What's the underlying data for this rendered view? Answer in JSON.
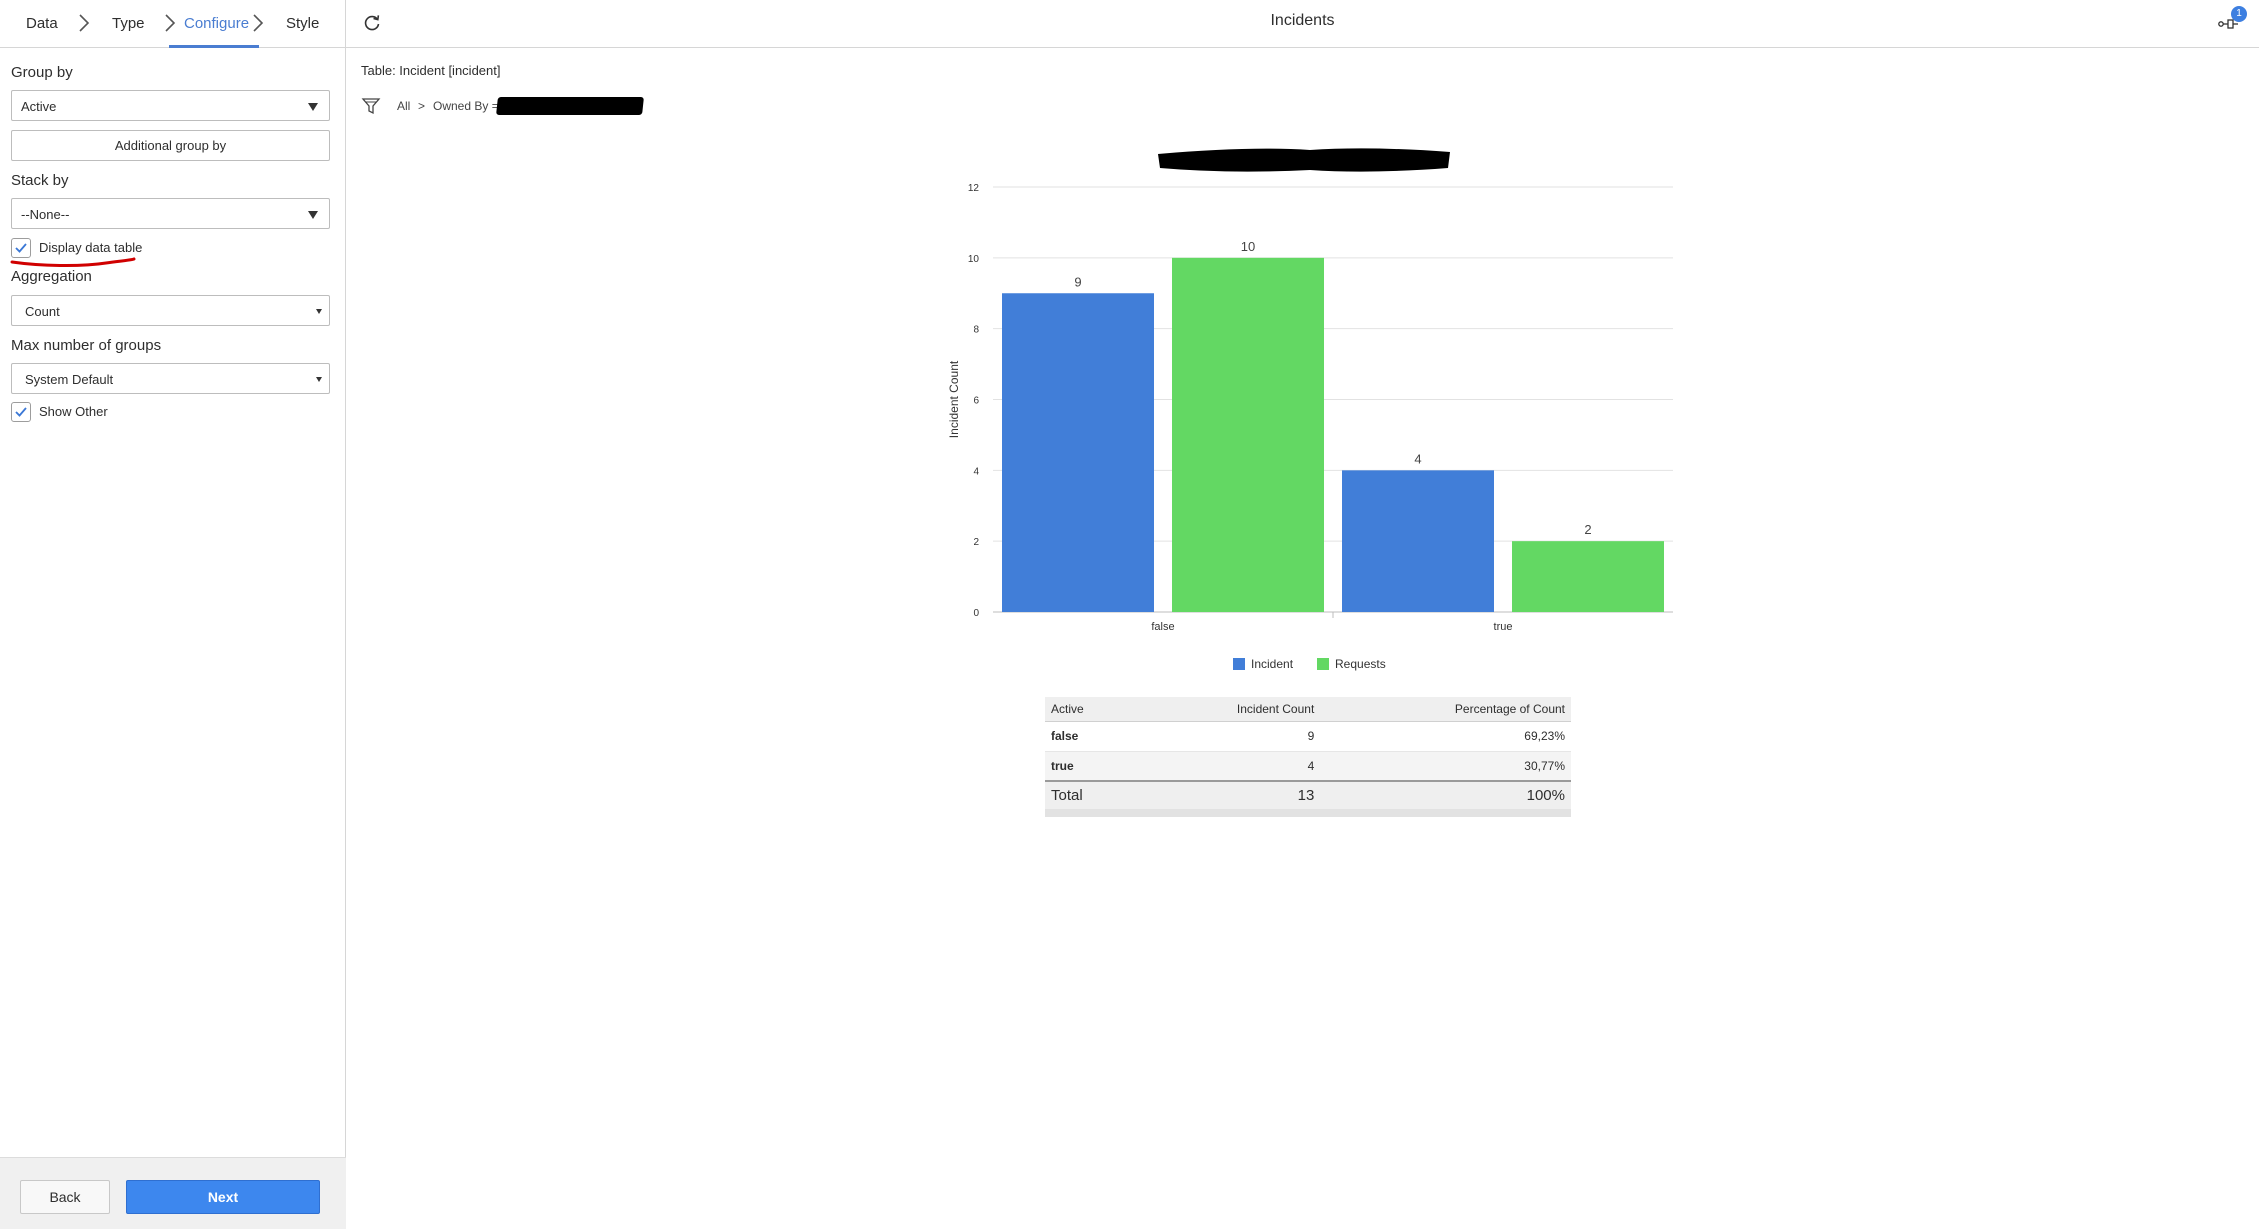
{
  "steps": [
    {
      "label": "Data"
    },
    {
      "label": "Type"
    },
    {
      "label": "Configure"
    },
    {
      "label": "Style"
    }
  ],
  "sidebar": {
    "group_by_label": "Group by",
    "group_by_value": "Active",
    "additional_group_by": "Additional group by",
    "stack_by_label": "Stack by",
    "stack_by_value": "--None--",
    "display_data_table_label": "Display data table",
    "display_data_table_checked": true,
    "aggregation_label": "Aggregation",
    "aggregation_value": "Count",
    "max_groups_label": "Max number of groups",
    "max_groups_value": "System Default",
    "show_other_label": "Show Other",
    "show_other_checked": true,
    "back_label": "Back",
    "next_label": "Next"
  },
  "header": {
    "title": "Incidents",
    "notification_count": "1"
  },
  "report": {
    "table_label": "Table: Incident [incident]",
    "filter_all": "All",
    "filter_sep": ">",
    "filter_owned_by": "Owned By ="
  },
  "chart_data": {
    "type": "bar",
    "categories": [
      "false",
      "true"
    ],
    "series": [
      {
        "name": "Incident",
        "values": [
          9,
          4
        ],
        "color": "#417ed8"
      },
      {
        "name": "Requests",
        "values": [
          10,
          2
        ],
        "color": "#63d863"
      }
    ],
    "ylabel": "Incident Count",
    "ylim": [
      0,
      12
    ],
    "yticks": [
      0,
      2,
      4,
      6,
      8,
      10,
      12
    ],
    "grid": true,
    "legend": "bottom"
  },
  "data_table": {
    "headers": [
      "Active",
      "Incident Count",
      "Percentage of Count"
    ],
    "rows": [
      [
        "false",
        "9",
        "69,23%"
      ],
      [
        "true",
        "4",
        "30,77%"
      ]
    ],
    "total": [
      "Total",
      "13",
      "100%"
    ]
  },
  "colors": {
    "accent": "#4a7dd1",
    "next_button": "#3d87ee",
    "annotation": "#d00000"
  }
}
